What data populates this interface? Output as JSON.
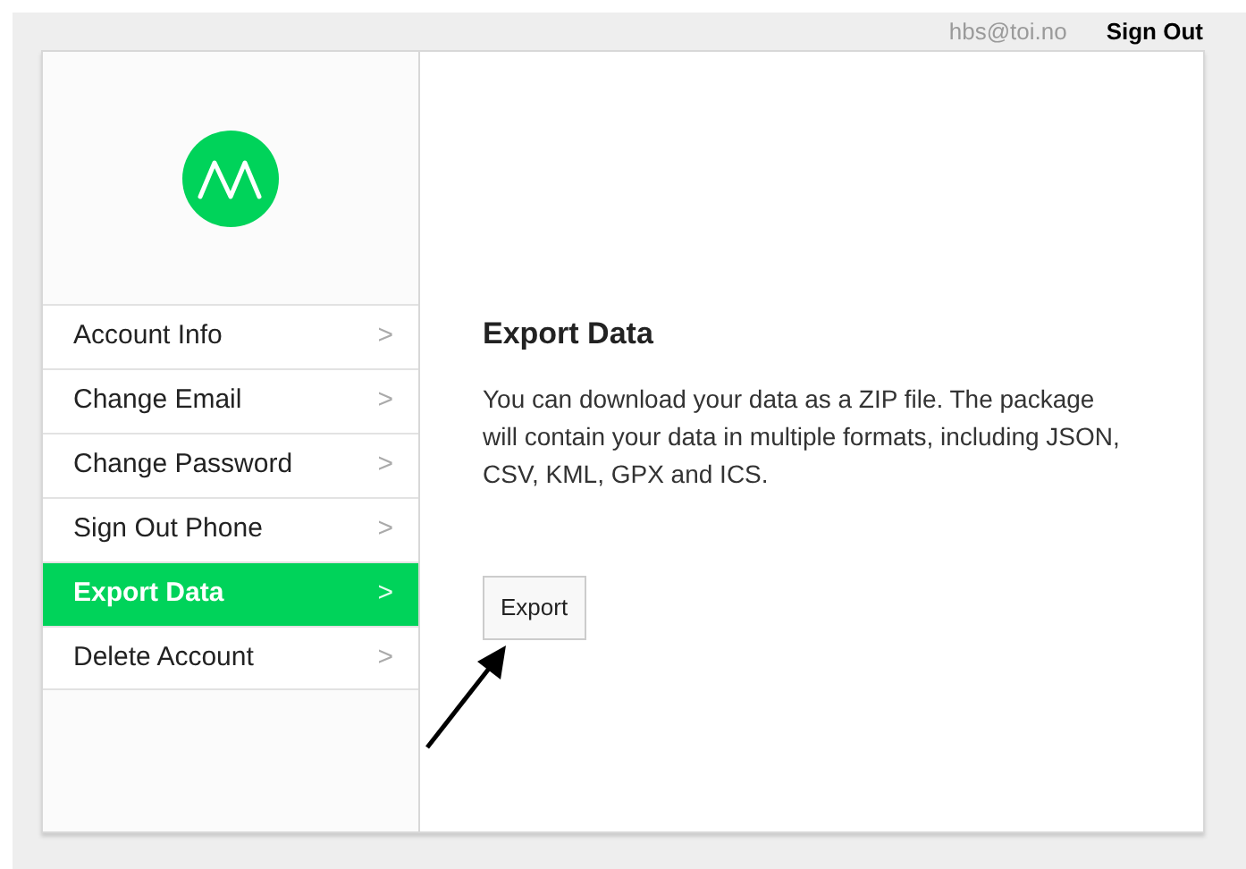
{
  "header": {
    "user_email": "hbs@toi.no",
    "sign_out": "Sign Out"
  },
  "sidebar": {
    "items": [
      {
        "label": "Account Info",
        "chevron": ">",
        "selected": false
      },
      {
        "label": "Change Email",
        "chevron": ">",
        "selected": false
      },
      {
        "label": "Change Password",
        "chevron": ">",
        "selected": false
      },
      {
        "label": "Sign Out Phone",
        "chevron": ">",
        "selected": false
      },
      {
        "label": "Export Data",
        "chevron": ">",
        "selected": true
      },
      {
        "label": "Delete Account",
        "chevron": ">",
        "selected": false
      }
    ]
  },
  "content": {
    "title": "Export Data",
    "description": "You can download your data as a ZIP file. The package will contain your data in multiple formats, including JSON, CSV, KML, GPX and ICS.",
    "button": "Export"
  }
}
